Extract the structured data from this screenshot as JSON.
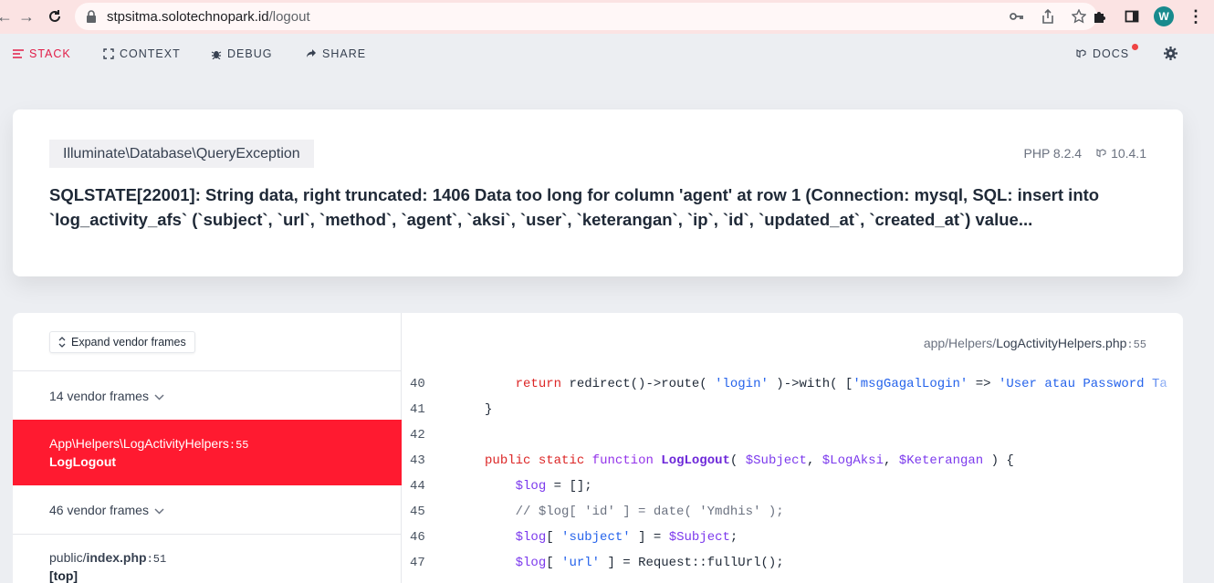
{
  "browser": {
    "url_host": "stpsitma.solotechnopark.id",
    "url_path": "/logout",
    "avatar_letter": "W"
  },
  "toolbar": {
    "stack": "STACK",
    "context": "CONTEXT",
    "debug": "DEBUG",
    "share": "SHARE",
    "docs": "DOCS"
  },
  "exception": {
    "class": "Illuminate\\Database\\QueryException",
    "php_version": "PHP 8.2.4",
    "laravel_version": "10.4.1",
    "message": "SQLSTATE[22001]: String data, right truncated: 1406 Data too long for column 'agent' at row 1 (Connection: mysql, SQL: insert into `log_activity_afs` (`subject`, `url`, `method`, `agent`, `aksi`, `user`, `keterangan`, `ip`, `id`, `updated_at`, `created_at`) value..."
  },
  "frames": {
    "expand_label": "Expand vendor frames",
    "group1": "14 vendor frames",
    "selected_path": "App\\Helpers\\LogActivityHelpers",
    "selected_line": ":55",
    "selected_fn": "LogLogout",
    "group2": "46 vendor frames",
    "last_dir": "public/",
    "last_file": "index.php",
    "last_line": ":51",
    "last_fn": "[top]"
  },
  "code": {
    "file_dir": "app/Helpers/",
    "file_name": "LogActivityHelpers.php",
    "file_line": ":55",
    "line_numbers": [
      "40",
      "41",
      "42",
      "43",
      "44",
      "45",
      "46",
      "47"
    ],
    "l40_kw": "return",
    "l40_a": " redirect()->route( ",
    "l40_s1": "'login'",
    "l40_b": " )->with( [",
    "l40_s2": "'msgGagalLogin'",
    "l40_c": " => ",
    "l40_s3": "'User atau Password Ta",
    "l41": "}",
    "l43_kw1": "public",
    "l43_kw2": "static",
    "l43_kw3": "function",
    "l43_fn": "LogLogout",
    "l43_v1": "$Subject",
    "l43_v2": "$LogAksi",
    "l43_v3": "$Keterangan",
    "l44_v": "$log",
    "l44_rest": " = [];",
    "l45": "// $log[ 'id' ] = date( 'Ymdhis' );",
    "l46_v": "$log",
    "l46_s": "'subject'",
    "l46_v2": "$Subject",
    "l47_v": "$log",
    "l47_s": "'url'",
    "l47_rest": " ] = Request::fullUrl();"
  }
}
